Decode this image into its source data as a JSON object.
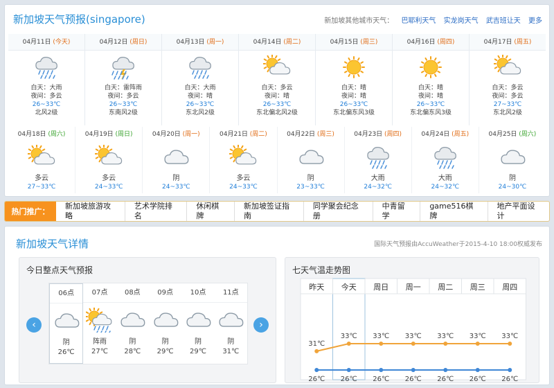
{
  "header": {
    "title": "新加坡天气预报(singapore)",
    "other_label": "新加坡其他城市天气：",
    "other_cities": [
      "巴耶利天气",
      "实龙岗天气",
      "武吉班让天"
    ],
    "more": "更多"
  },
  "week1": [
    {
      "date": "04月11日",
      "weekday": "(今天)",
      "icon": "rain-icon",
      "day": "白天：大雨",
      "night": "夜间：多云",
      "temp": "26~33℃",
      "wind": "北风2级"
    },
    {
      "date": "04月12日",
      "weekday": "(周日)",
      "icon": "thunder-rain-icon",
      "day": "白天：雷阵雨",
      "night": "夜间：多云",
      "temp": "26~33℃",
      "wind": "东南风2级"
    },
    {
      "date": "04月13日",
      "weekday": "(周一)",
      "icon": "rain-icon",
      "day": "白天：大雨",
      "night": "夜间：晴",
      "temp": "26~33℃",
      "wind": "东北风2级"
    },
    {
      "date": "04月14日",
      "weekday": "(周二)",
      "icon": "partly-cloudy-icon",
      "day": "白天：多云",
      "night": "夜间：晴",
      "temp": "26~33℃",
      "wind": "东北偏北风2级"
    },
    {
      "date": "04月15日",
      "weekday": "(周三)",
      "icon": "sun-icon",
      "day": "白天：晴",
      "night": "夜间：晴",
      "temp": "26~33℃",
      "wind": "东北偏东风3级"
    },
    {
      "date": "04月16日",
      "weekday": "(周四)",
      "icon": "sun-icon",
      "day": "白天：晴",
      "night": "夜间：晴",
      "temp": "26~33℃",
      "wind": "东北偏东风3级"
    },
    {
      "date": "04月17日",
      "weekday": "(周五)",
      "icon": "partly-cloudy-icon",
      "day": "白天：多云",
      "night": "夜间：多云",
      "temp": "27~33℃",
      "wind": "东北风2级"
    }
  ],
  "week2": [
    {
      "date": "04月18日",
      "weekday": "(周六)",
      "icon": "partly-cloudy-icon",
      "cond": "多云",
      "temp": "27~33℃"
    },
    {
      "date": "04月19日",
      "weekday": "(周日)",
      "icon": "partly-cloudy-icon",
      "cond": "多云",
      "temp": "24~33℃"
    },
    {
      "date": "04月20日",
      "weekday": "(周一)",
      "icon": "cloud-icon",
      "cond": "阴",
      "temp": "24~33℃"
    },
    {
      "date": "04月21日",
      "weekday": "(周二)",
      "icon": "partly-cloudy-icon",
      "cond": "多云",
      "temp": "24~33℃"
    },
    {
      "date": "04月22日",
      "weekday": "(周三)",
      "icon": "cloud-icon",
      "cond": "阴",
      "temp": "23~33℃"
    },
    {
      "date": "04月23日",
      "weekday": "(周四)",
      "icon": "rain-icon",
      "cond": "大雨",
      "temp": "24~32℃"
    },
    {
      "date": "04月24日",
      "weekday": "(周五)",
      "icon": "rain-icon",
      "cond": "大雨",
      "temp": "24~32℃"
    },
    {
      "date": "04月25日",
      "weekday": "(周六)",
      "icon": "cloud-icon",
      "cond": "阴",
      "temp": "24~30℃"
    }
  ],
  "promo": {
    "label": "热门推广：",
    "items": [
      {
        "text": "新加坡旅游攻略",
        "hot": true
      },
      {
        "text": "艺术学院排名",
        "hot": true
      },
      {
        "text": "休闲棋牌",
        "hot": true
      },
      {
        "text": "新加坡签证指南",
        "hot": false
      },
      {
        "text": "同学聚会纪念册",
        "hot": false
      },
      {
        "text": "中青留学",
        "hot": false
      },
      {
        "text": "game516棋牌",
        "hot": false
      },
      {
        "text": "地产平面设计",
        "hot": false
      }
    ],
    "hot_badge": "热"
  },
  "detail": {
    "title": "新加坡天气详情",
    "source": "国际天气预报由AccuWeather于2015-4-10 18:00权威发布",
    "hourly_title": "今日整点天气预报",
    "trend_title": "七天气温走势图"
  },
  "hourly": [
    {
      "hour": "06点",
      "icon": "cloud-icon",
      "cond": "阴",
      "temp": "26℃"
    },
    {
      "hour": "07点",
      "icon": "sun-rain-icon",
      "cond": "阵雨",
      "temp": "27℃"
    },
    {
      "hour": "08点",
      "icon": "cloud-icon",
      "cond": "阴",
      "temp": "28℃"
    },
    {
      "hour": "09点",
      "icon": "cloud-icon",
      "cond": "阴",
      "temp": "29℃"
    },
    {
      "hour": "10点",
      "icon": "cloud-icon",
      "cond": "阴",
      "temp": "29℃"
    },
    {
      "hour": "11点",
      "icon": "cloud-icon",
      "cond": "阴",
      "temp": "31℃"
    }
  ],
  "colors": {
    "accent": "#2a8fd6",
    "high_line": "#f0a43a",
    "low_line": "#3f87d6",
    "orange_text": "#e06b14"
  },
  "chart_data": {
    "type": "line",
    "categories": [
      "昨天",
      "今天",
      "周日",
      "周一",
      "周二",
      "周三",
      "周四"
    ],
    "series": [
      {
        "values": [
          31,
          33,
          33,
          33,
          33,
          33,
          33
        ]
      },
      {
        "values": [
          26,
          26,
          26,
          26,
          26,
          26,
          26
        ]
      }
    ],
    "high_labels": [
      "31℃",
      "33℃",
      "33℃",
      "33℃",
      "33℃",
      "33℃",
      "33℃"
    ],
    "low_labels": [
      "26℃",
      "26℃",
      "26℃",
      "26℃",
      "26℃",
      "26℃",
      "26℃"
    ],
    "highlight": "今天"
  }
}
